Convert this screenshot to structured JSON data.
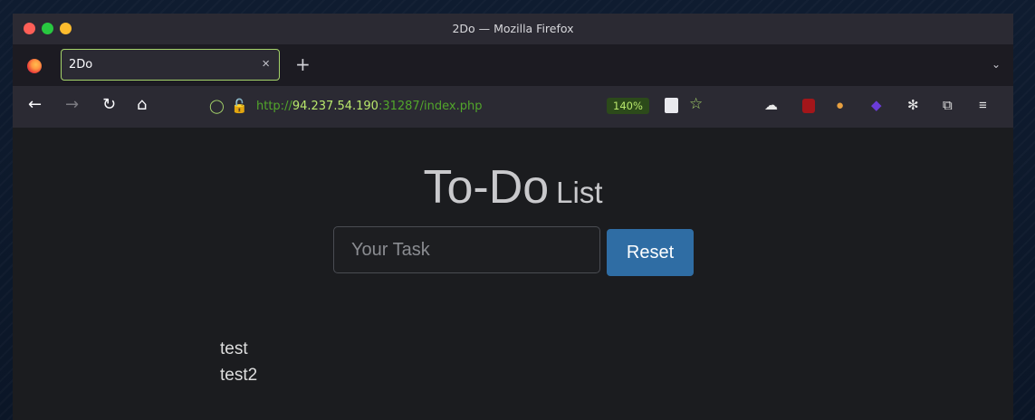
{
  "window": {
    "title": "2Do — Mozilla Firefox"
  },
  "tabs": [
    {
      "label": "2Do",
      "active": true
    }
  ],
  "toolbar": {
    "new_tab": "+",
    "close_tab": "×"
  },
  "nav": {
    "url_scheme": "http://",
    "url_host": "94.237.54.190",
    "url_rest": ":31287/index.php",
    "zoom": "140%"
  },
  "page": {
    "title_main": "To-Do",
    "title_sub": "List",
    "input_placeholder": "Your Task",
    "input_value": "",
    "reset_label": "Reset",
    "tasks": [
      "test",
      "test2"
    ]
  },
  "colors": {
    "accent_button": "#2f6da4",
    "tab_border": "#a5d36a",
    "url_host": "#b9e86c",
    "page_bg": "#1b1c1f"
  }
}
